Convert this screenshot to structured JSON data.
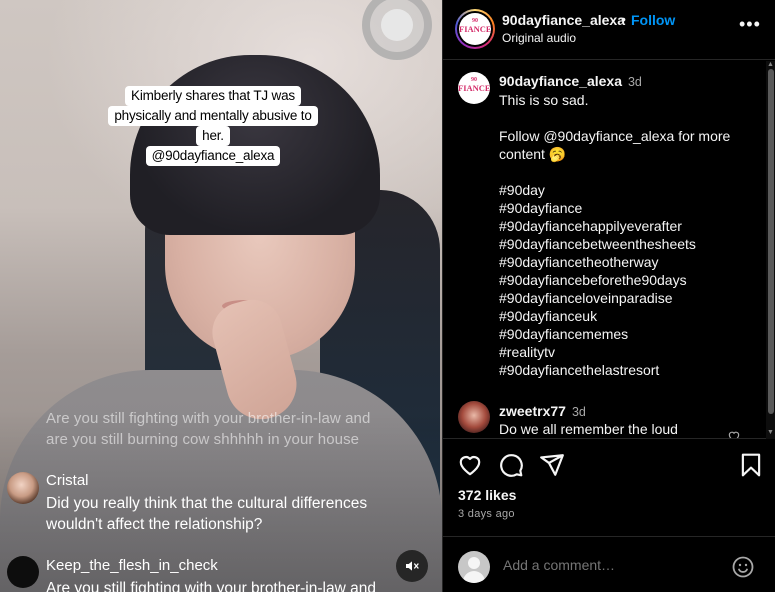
{
  "video": {
    "caption_lines": [
      "Kimberly shares that TJ was",
      "physically and mentally abusive to",
      "her.",
      "@90dayfiance_alexa"
    ],
    "live_comments": [
      {
        "text_lines": [
          "Are you still fighting with your brother-in-law and",
          "are you still burning cow shhhhh in your house"
        ]
      },
      {
        "user": "Cristal",
        "text_lines": [
          "Did you really think that the cultural differences",
          "wouldn't affect the relationship?"
        ]
      },
      {
        "user": "Keep_the_flesh_in_check",
        "text_lines": [
          "Are you still fighting with your brother-in-law and"
        ]
      }
    ]
  },
  "header": {
    "username": "90dayfiance_alexa",
    "follow_label": "Follow",
    "separator": "•",
    "audio": "Original audio",
    "logo_text": "FIANCE",
    "logo_top": "90"
  },
  "post": {
    "username": "90dayfiance_alexa",
    "time": "3d",
    "lines": [
      "This is so sad.",
      "",
      "Follow @90dayfiance_alexa for more",
      "content 🥱",
      "",
      "#90day",
      "#90dayfiance",
      "#90dayfiancehappilyeverafter",
      "#90dayfiancebetweenthesheets",
      "#90dayfiancetheotherway",
      "#90dayfiancebeforethe90days",
      "#90dayfianceloveinparadise",
      "#90dayfianceuk",
      "#90dayfiancememes",
      "#realitytv",
      "#90dayfiancethelastresort"
    ]
  },
  "comment": {
    "username": "zweetrx77",
    "time": "3d",
    "text": "Do we all remember the loud"
  },
  "stats": {
    "likes": "372 likes",
    "ago": "3 days ago"
  },
  "add_comment": {
    "placeholder": "Add a comment…"
  },
  "icons": [
    "heart-icon",
    "comment-icon",
    "share-icon",
    "bookmark-icon",
    "mute-icon",
    "emoji-icon",
    "more-icon"
  ]
}
